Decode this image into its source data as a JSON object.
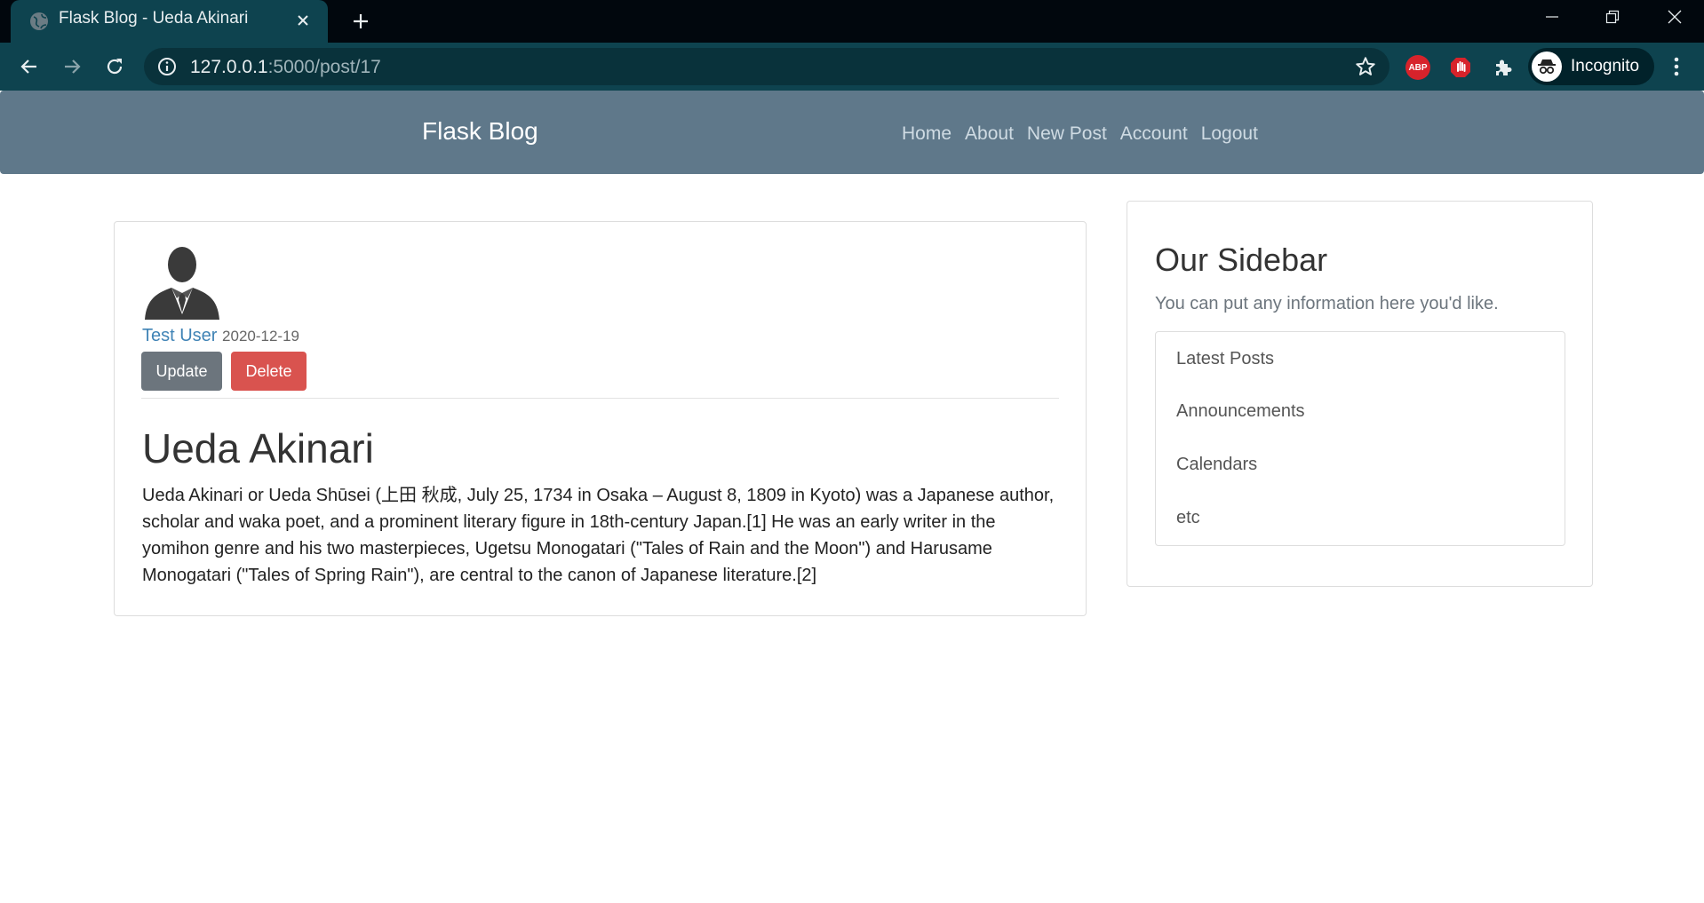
{
  "browser": {
    "tab_title": "Flask Blog - Ueda Akinari",
    "url_host": "127.0.0.1",
    "url_path": ":5000/post/17",
    "profile_label": "Incognito",
    "extensions": {
      "abp_label": "ABP"
    }
  },
  "site": {
    "brand": "Flask Blog",
    "nav": [
      "Home",
      "About",
      "New Post",
      "Account",
      "Logout"
    ]
  },
  "post": {
    "author": "Test User",
    "date": "2020-12-19",
    "update_label": "Update",
    "delete_label": "Delete",
    "title": "Ueda Akinari",
    "content": "Ueda Akinari or Ueda Shūsei (上田 秋成, July 25, 1734 in Osaka – August 8, 1809 in Kyoto) was a Japanese author, scholar and waka poet, and a prominent literary figure in 18th-century Japan.[1] He was an early writer in the yomihon genre and his two masterpieces, Ugetsu Monogatari (\"Tales of Rain and the Moon\") and Harusame Monogatari (\"Tales of Spring Rain\"), are central to the canon of Japanese literature.[2]"
  },
  "sidebar": {
    "title": "Our Sidebar",
    "description": "You can put any information here you'd like.",
    "items": [
      "Latest Posts",
      "Announcements",
      "Calendars",
      "etc"
    ]
  },
  "colors": {
    "navbar": "#5f788a",
    "chrome_toolbar": "#0e434f",
    "update_button": "#6c757d",
    "delete_button": "#d9534f",
    "author_link": "#3f83b5"
  },
  "icons": [
    "globe-icon",
    "close-icon",
    "plus-icon",
    "minimize-icon",
    "restore-icon",
    "window-close-icon",
    "back-arrow-icon",
    "forward-arrow-icon",
    "reload-icon",
    "info-icon",
    "star-icon",
    "adblock-icon",
    "stop-hand-icon",
    "puzzle-icon",
    "incognito-icon",
    "kebab-menu-icon",
    "user-avatar-icon"
  ]
}
